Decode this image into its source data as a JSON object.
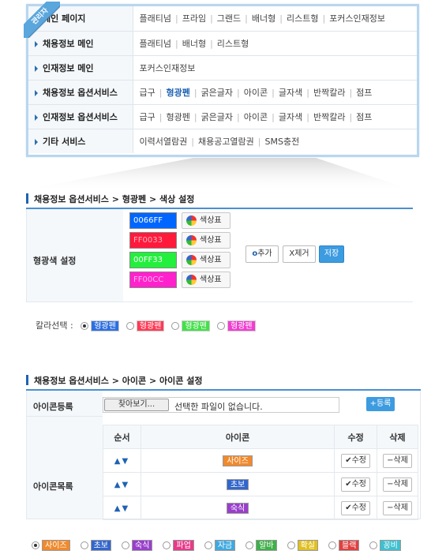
{
  "badge": "관리자",
  "menu": [
    {
      "label": "메인 페이지",
      "values": [
        "플래티넘",
        "프라임",
        "그랜드",
        "배너형",
        "리스트형",
        "포커스인재정보"
      ],
      "highlight": -1
    },
    {
      "label": "채용정보 메인",
      "values": [
        "플래티넘",
        "배너형",
        "리스트형"
      ],
      "highlight": -1
    },
    {
      "label": "인재정보 메인",
      "values": [
        "포커스인재정보"
      ],
      "highlight": -1
    },
    {
      "label": "채용정보 옵션서비스",
      "values": [
        "급구",
        "형광펜",
        "굵은글자",
        "아이콘",
        "글자색",
        "반짝칼라",
        "점프"
      ],
      "highlight": 1
    },
    {
      "label": "인재정보 옵션서비스",
      "values": [
        "급구",
        "형광펜",
        "굵은글자",
        "아이콘",
        "글자색",
        "반짝칼라",
        "점프"
      ],
      "highlight": -1
    },
    {
      "label": "기타 서비스",
      "values": [
        "이력서열람권",
        "채용공고열람권",
        "SMS충전"
      ],
      "highlight": -1
    }
  ],
  "color_section": {
    "title": "채용정보 옵션서비스 > 형광펜 > 색상 설정",
    "label": "형광색 설정",
    "rows": [
      {
        "value": "0066FF",
        "bg": "#0066ff",
        "fg": "#ffffff"
      },
      {
        "value": "FF0033",
        "bg": "#ff1a3c",
        "fg": "#ffb3c0"
      },
      {
        "value": "00FF33",
        "bg": "#22f03c",
        "fg": "#ffffff"
      },
      {
        "value": "FF00CC",
        "bg": "#ff22cc",
        "fg": "#ffb3ec"
      }
    ],
    "chart_button": "색상표",
    "add": "추가",
    "remove": "제거",
    "save": "저장"
  },
  "color_pick": {
    "label": "칼라선택 :",
    "options": [
      {
        "text": "형광펜",
        "bg": "#2d6fe0",
        "fg": "#fff",
        "on": true
      },
      {
        "text": "형광펜",
        "bg": "#ff3b55",
        "fg": "#fff",
        "on": false
      },
      {
        "text": "형광펜",
        "bg": "#44e04a",
        "fg": "#fff",
        "on": false
      },
      {
        "text": "형광펜",
        "bg": "#f03fd0",
        "fg": "#fff",
        "on": false
      }
    ]
  },
  "icon_section": {
    "title": "채용정보 옵션서비스 > 아이콘 > 아이콘 설정",
    "register_label": "아이콘등록",
    "browse": "찾아보기...",
    "no_file": "선택한 파일이 없습니다.",
    "add": "등록",
    "list_label": "아이콘목록",
    "headers": [
      "순서",
      "아이콘",
      "수정",
      "삭제"
    ],
    "rows": [
      {
        "icon": "사이즈",
        "bg": "#f08a2c"
      },
      {
        "icon": "초보",
        "bg": "#3366cc"
      },
      {
        "icon": "숙식",
        "bg": "#9a3fcc"
      }
    ],
    "edit": "수정",
    "delete": "삭제"
  },
  "icon_pick": [
    {
      "text": "사이즈",
      "bg": "#f08a2c",
      "on": true
    },
    {
      "text": "초보",
      "bg": "#3366cc",
      "on": false
    },
    {
      "text": "숙식",
      "bg": "#9a3fcc",
      "on": false
    },
    {
      "text": "파업",
      "bg": "#e83a8a",
      "on": false
    },
    {
      "text": "자금",
      "bg": "#3fa9e0",
      "on": false
    },
    {
      "text": "알바",
      "bg": "#3fb04a",
      "on": false
    },
    {
      "text": "확실",
      "bg": "#e0c020",
      "on": false
    },
    {
      "text": "블랙",
      "bg": "#e04040",
      "on": false
    },
    {
      "text": "꽁비",
      "bg": "#3fc0d0",
      "on": false
    }
  ]
}
